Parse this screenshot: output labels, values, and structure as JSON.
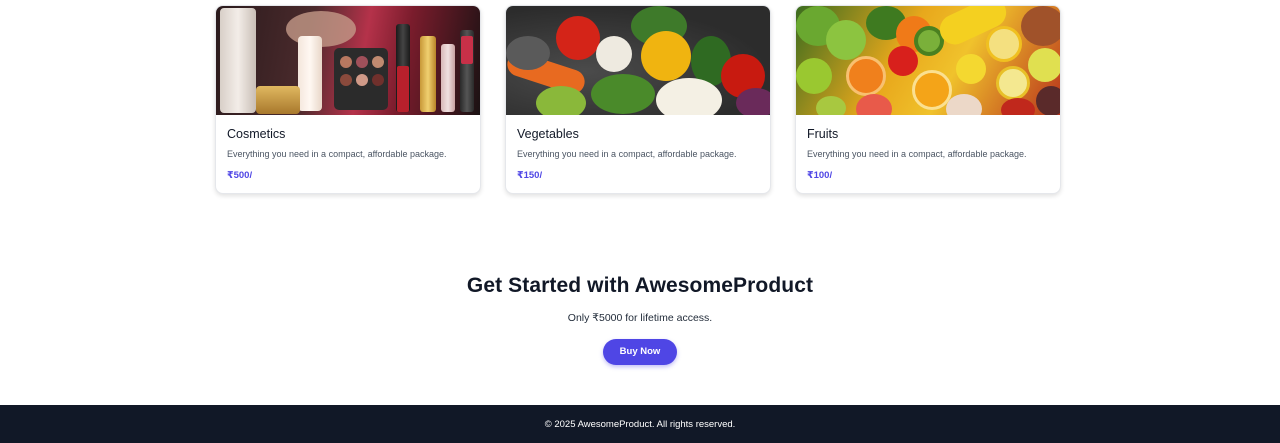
{
  "products": [
    {
      "title": "Cosmetics",
      "description": "Everything you need in a compact, affordable package.",
      "price": "₹500/",
      "image": "cosmetics-photo"
    },
    {
      "title": "Vegetables",
      "description": "Everything you need in a compact, affordable package.",
      "price": "₹150/",
      "image": "vegetables-photo"
    },
    {
      "title": "Fruits",
      "description": "Everything you need in a compact, affordable package.",
      "price": "₹100/",
      "image": "fruits-photo"
    }
  ],
  "cta": {
    "title": "Get Started with AwesomeProduct",
    "subtitle": "Only ₹5000 for lifetime access.",
    "button_label": "Buy Now"
  },
  "footer": {
    "text": "© 2025 AwesomeProduct. All rights reserved."
  },
  "colors": {
    "accent": "#4f46e5",
    "footer_bg": "#111827"
  }
}
